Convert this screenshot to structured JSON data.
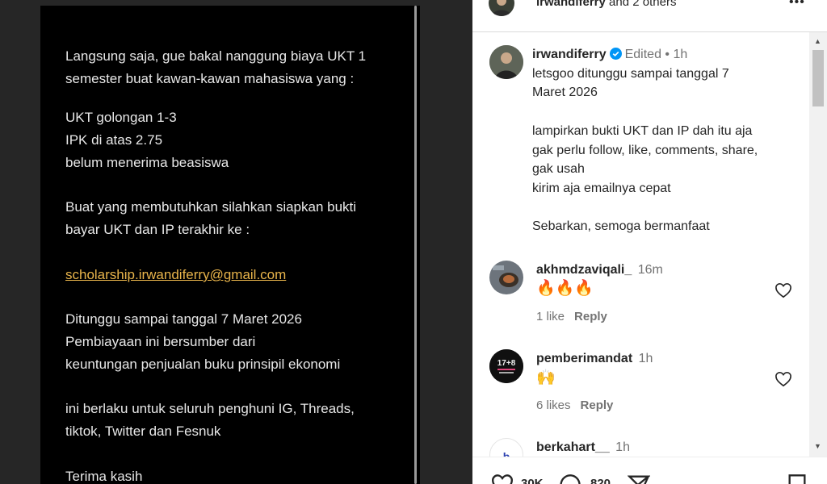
{
  "post": {
    "lines": [
      "Langsung saja, gue bakal nanggung biaya UKT 1",
      "semester buat kawan-kawan mahasiswa yang :",
      "UKT golongan 1-3",
      "IPK di atas 2.75",
      "belum menerima beasiswa",
      "Buat yang membutuhkan silahkan siapkan bukti",
      "bayar UKT dan IP terakhir ke :",
      "scholarship.irwandiferry@gmail.com",
      "Ditunggu sampai tanggal 7 Maret 2026",
      "Pembiayaan ini bersumber dari",
      "keuntungan penjualan buku prinsipil ekonomi",
      "ini berlaku untuk seluruh penghuni IG, Threads,",
      "tiktok, Twitter dan Fesnuk",
      "Terima kasih"
    ]
  },
  "header": {
    "username": "irwandiferry",
    "others": "and 2 others"
  },
  "caption": {
    "username": "irwandiferry",
    "edited": "Edited",
    "dot": "•",
    "time": "1h",
    "lines": [
      "letsgoo ditunggu sampai tanggal 7",
      "Maret 2026",
      "lampirkan bukti UKT dan IP dah itu aja",
      "gak perlu follow, like, comments, share,",
      "gak usah",
      "kirim aja emailnya cepat",
      "Sebarkan, semoga bermanfaat"
    ]
  },
  "comments": [
    {
      "username": "akhmdzaviqali_",
      "time": "16m",
      "text": "🔥🔥🔥",
      "likes": "1 like",
      "reply": "Reply"
    },
    {
      "username": "pemberimandat",
      "time": "1h",
      "text": "🙌",
      "likes": "6 likes",
      "reply": "Reply",
      "avatar_text": "17+8"
    },
    {
      "username": "berkahart__",
      "time": "1h",
      "avatar_text": "b"
    }
  ],
  "actions": {
    "likes_count": "30K",
    "comments_count": "820"
  },
  "colors": {
    "link": "#e8b44b",
    "verified": "#0095f6"
  }
}
